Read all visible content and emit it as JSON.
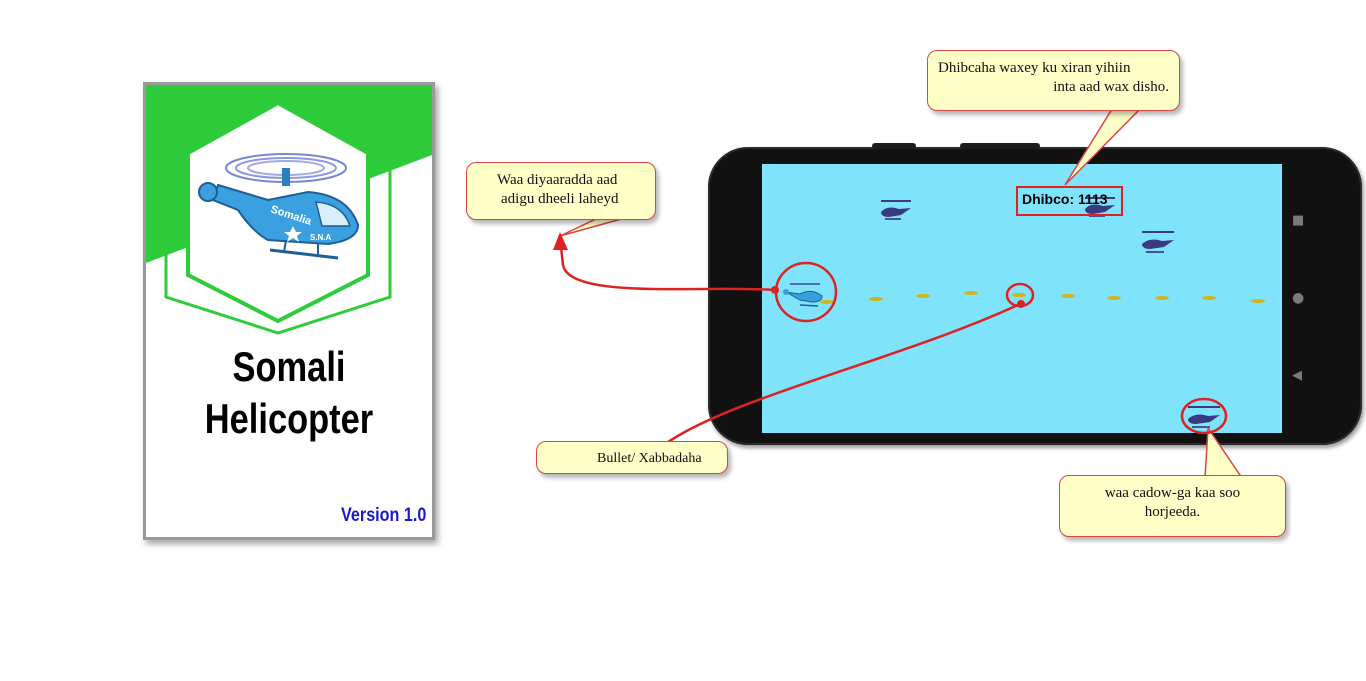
{
  "cover": {
    "title_line1": "Somali",
    "title_line2": "Helicopter",
    "version": "Version 1.0",
    "logo_text_main": "Somalia",
    "logo_text_sub": "S.N.A",
    "brand_green": "#2ecc3b"
  },
  "game": {
    "score_label": "Dhibco: 1113",
    "sky_color": "#7fe3fb",
    "player_icon": "player-helicopter-icon",
    "enemy_icon": "enemy-helicopter-icon",
    "bullet_icon": "bullet-icon"
  },
  "phone_nav": {
    "recents_icon": "square-icon",
    "home_icon": "circle-icon",
    "back_icon": "triangle-back-icon"
  },
  "callouts": {
    "score_note_line1": "Dhibcaha waxey ku xiran yihiin",
    "score_note_line2": "inta aad wax disho.",
    "player_note_line1": "Waa diyaaradda aad",
    "player_note_line2": "adigu dheeli laheyd",
    "bullet_note": "Bullet/ Xabbadaha",
    "enemy_note_line1": "waa cadow-ga kaa soo",
    "enemy_note_line2": "horjeeda."
  },
  "colors": {
    "callout_bg": "#ffffc8",
    "callout_border": "#dd4444",
    "marker_red": "#dd2222",
    "version_blue": "#1a1acc"
  }
}
